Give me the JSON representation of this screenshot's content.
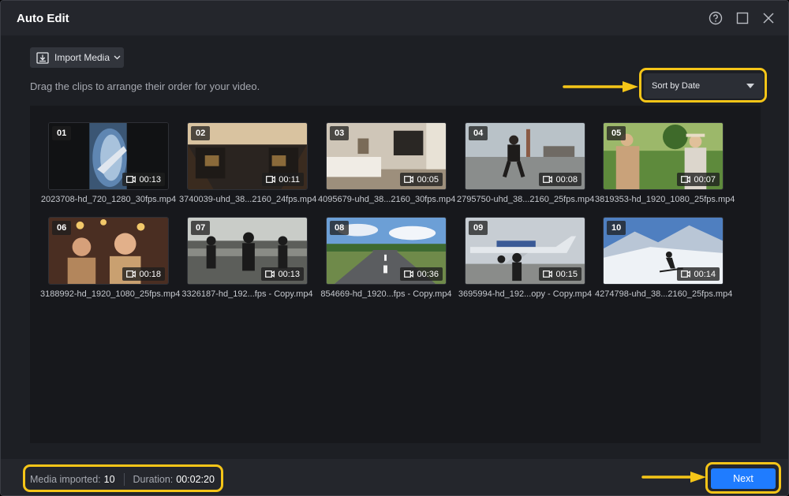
{
  "window": {
    "title": "Auto Edit"
  },
  "toolbar": {
    "import_label": "Import Media"
  },
  "hint": "Drag the clips to arrange their order for your video.",
  "sort": {
    "selected": "Sort by Date"
  },
  "clips": [
    {
      "num": "01",
      "duration": "00:13",
      "filename": "2023708-hd_720_1280_30fps.mp4"
    },
    {
      "num": "02",
      "duration": "00:11",
      "filename": "3740039-uhd_38...2160_24fps.mp4"
    },
    {
      "num": "03",
      "duration": "00:05",
      "filename": "4095679-uhd_38...2160_30fps.mp4"
    },
    {
      "num": "04",
      "duration": "00:08",
      "filename": "2795750-uhd_38...2160_25fps.mp4"
    },
    {
      "num": "05",
      "duration": "00:07",
      "filename": "3819353-hd_1920_1080_25fps.mp4"
    },
    {
      "num": "06",
      "duration": "00:18",
      "filename": "3188992-hd_1920_1080_25fps.mp4"
    },
    {
      "num": "07",
      "duration": "00:13",
      "filename": "3326187-hd_192...fps - Copy.mp4"
    },
    {
      "num": "08",
      "duration": "00:36",
      "filename": "854669-hd_1920...fps - Copy.mp4"
    },
    {
      "num": "09",
      "duration": "00:15",
      "filename": "3695994-hd_192...opy - Copy.mp4"
    },
    {
      "num": "10",
      "duration": "00:14",
      "filename": "4274798-uhd_38...2160_25fps.mp4"
    }
  ],
  "footer": {
    "media_label": "Media imported:",
    "media_count": "10",
    "duration_label": "Duration:",
    "duration_value": "00:02:20",
    "next_label": "Next"
  },
  "colors": {
    "accent": "#1f7cff",
    "highlight": "#f5c518"
  }
}
